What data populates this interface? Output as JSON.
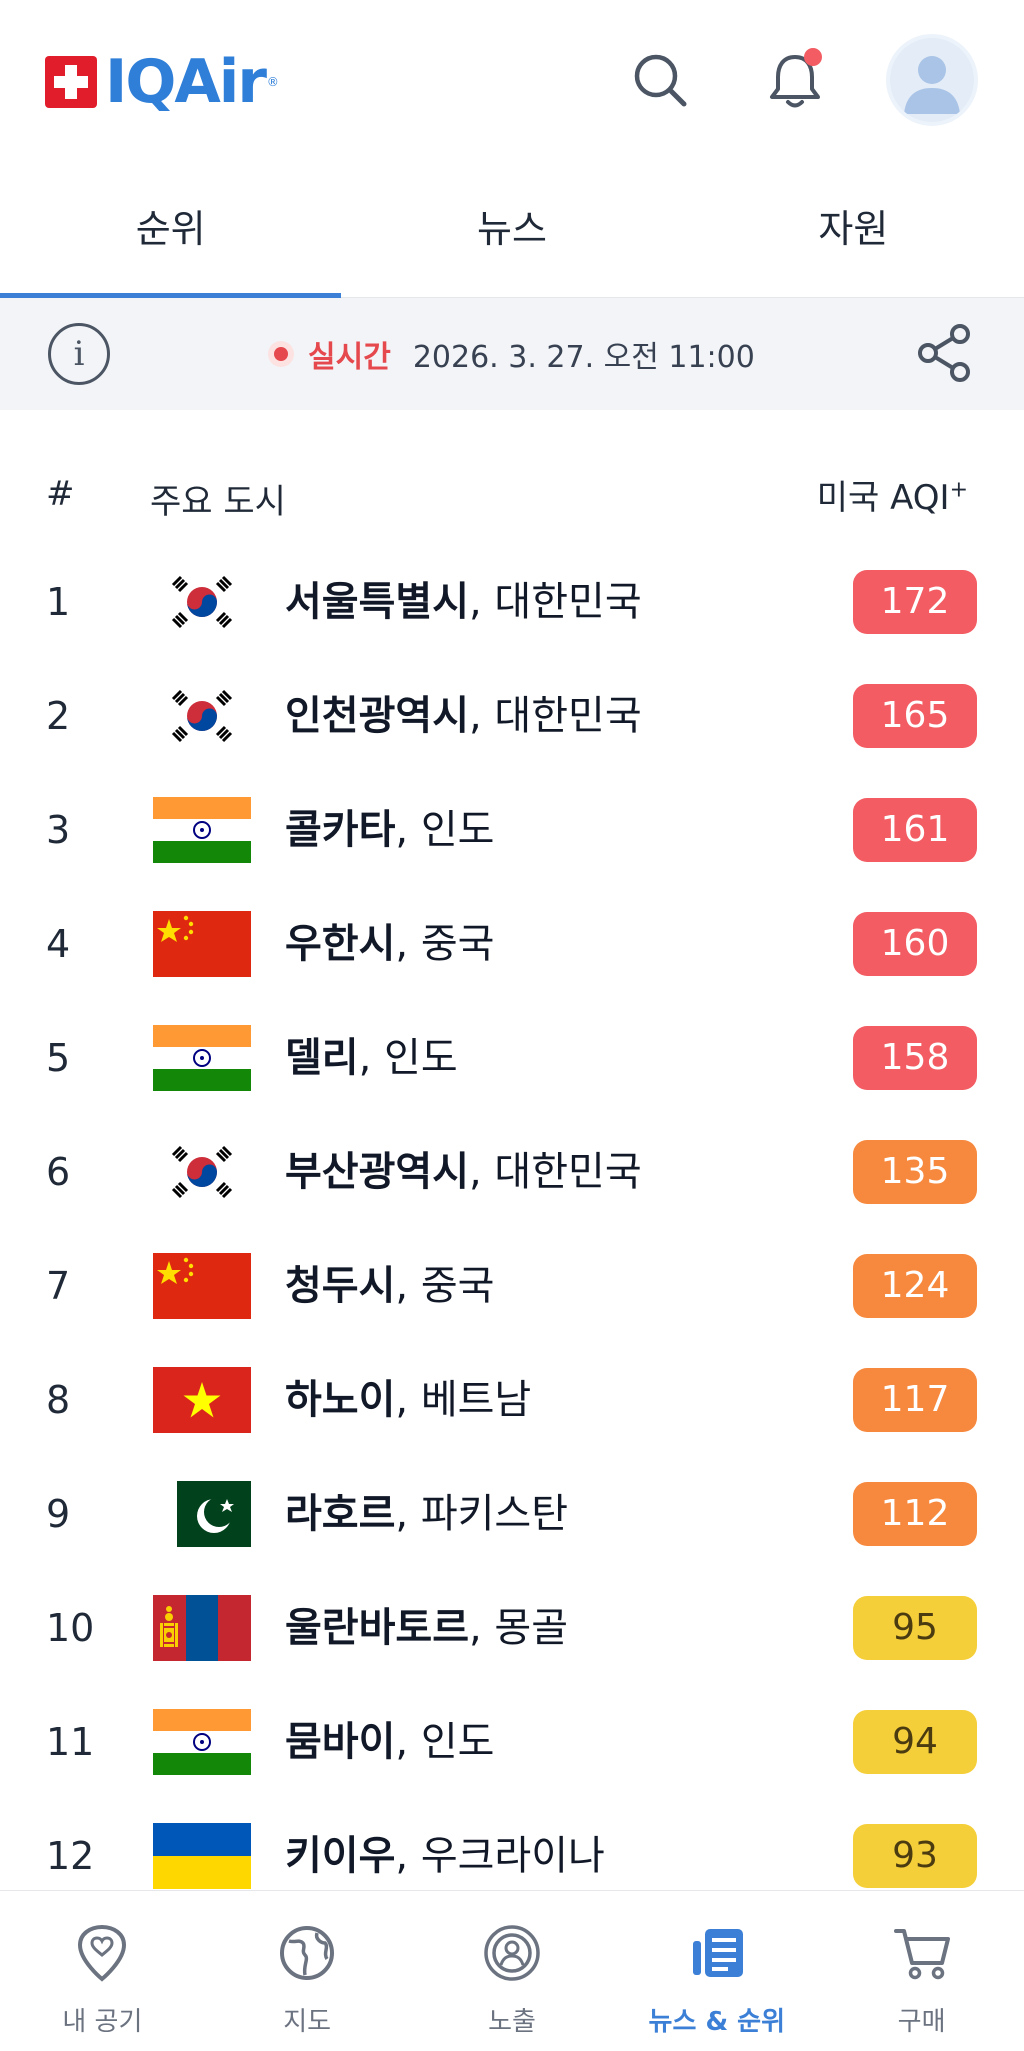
{
  "header": {
    "logo_text": "IQAir",
    "logo_registered": "®",
    "icons": [
      "swiss-cross-icon",
      "search-icon",
      "bell-icon",
      "avatar-icon"
    ],
    "notification_dot_color": "#f25c62"
  },
  "tabs": [
    {
      "label": "순위",
      "active": true
    },
    {
      "label": "뉴스",
      "active": false
    },
    {
      "label": "자원",
      "active": false
    }
  ],
  "live": {
    "label": "실시간",
    "timestamp": "2026. 3. 27. 오전 11:00"
  },
  "table": {
    "col_rank": "#",
    "col_city": "주요 도시",
    "col_aqi": "미국 AQI",
    "col_aqi_sup": "+",
    "rows": [
      {
        "rank": "1",
        "city": "서울특별시",
        "country": ", 대한민국",
        "aqi": "172",
        "flag": "korea-flag-icon",
        "level": "red"
      },
      {
        "rank": "2",
        "city": "인천광역시",
        "country": ", 대한민국",
        "aqi": "165",
        "flag": "korea-flag-icon",
        "level": "red"
      },
      {
        "rank": "3",
        "city": "콜카타",
        "country": ", 인도",
        "aqi": "161",
        "flag": "india-flag-icon",
        "level": "red"
      },
      {
        "rank": "4",
        "city": "우한시",
        "country": ", 중국",
        "aqi": "160",
        "flag": "china-flag-icon",
        "level": "red"
      },
      {
        "rank": "5",
        "city": "델리",
        "country": ", 인도",
        "aqi": "158",
        "flag": "india-flag-icon",
        "level": "red"
      },
      {
        "rank": "6",
        "city": "부산광역시",
        "country": ", 대한민국",
        "aqi": "135",
        "flag": "korea-flag-icon",
        "level": "orange"
      },
      {
        "rank": "7",
        "city": "청두시",
        "country": ", 중국",
        "aqi": "124",
        "flag": "china-flag-icon",
        "level": "orange"
      },
      {
        "rank": "8",
        "city": "하노이",
        "country": ", 베트남",
        "aqi": "117",
        "flag": "vietnam-flag-icon",
        "level": "orange"
      },
      {
        "rank": "9",
        "city": "라호르",
        "country": ", 파키스탄",
        "aqi": "112",
        "flag": "pakistan-flag-icon",
        "level": "orange"
      },
      {
        "rank": "10",
        "city": "울란바토르",
        "country": ", 몽골",
        "aqi": "95",
        "flag": "mongolia-flag-icon",
        "level": "yellow"
      },
      {
        "rank": "11",
        "city": "뭄바이",
        "country": ", 인도",
        "aqi": "94",
        "flag": "india-flag-icon",
        "level": "yellow"
      },
      {
        "rank": "12",
        "city": "키이우",
        "country": ", 우크라이나",
        "aqi": "93",
        "flag": "ukraine-flag-icon",
        "level": "yellow"
      }
    ]
  },
  "aqi_colors": {
    "red": "#f25c62",
    "orange": "#f7893f",
    "yellow": "#f5cf3a"
  },
  "bottom_nav": [
    {
      "label": "내 공기",
      "icon": "heart-pin-icon",
      "active": false
    },
    {
      "label": "지도",
      "icon": "globe-icon",
      "active": false
    },
    {
      "label": "노출",
      "icon": "exposure-icon",
      "active": false
    },
    {
      "label": "뉴스 & 순위",
      "icon": "news-icon",
      "active": true
    },
    {
      "label": "구매",
      "icon": "cart-icon",
      "active": false
    }
  ],
  "accent_color": "#3b7fd6"
}
